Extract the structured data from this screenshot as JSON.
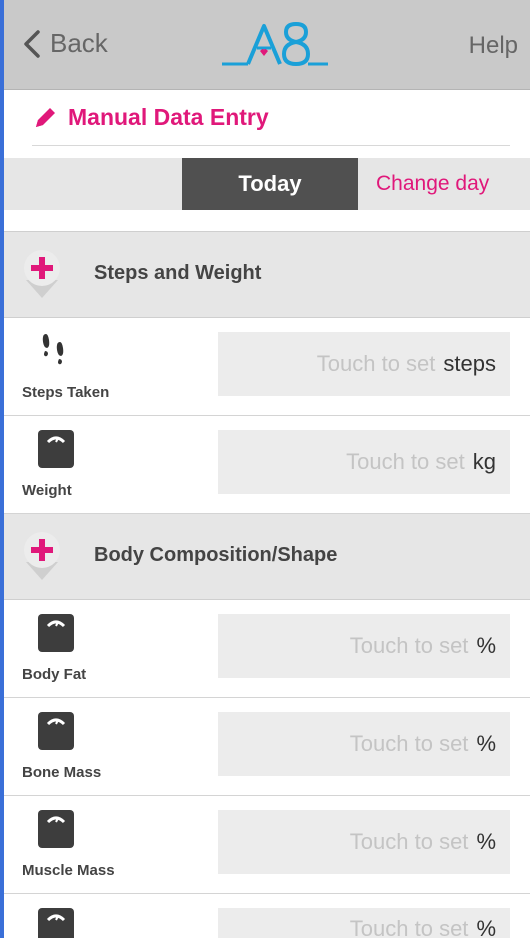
{
  "nav": {
    "back_label": "Back",
    "help_label": "Help",
    "logo_text": "A8"
  },
  "header": {
    "title": "Manual Data Entry"
  },
  "day_selector": {
    "today_label": "Today",
    "change_day_label": "Change day"
  },
  "sections": [
    {
      "label": "Steps and Weight",
      "rows": [
        {
          "label": "Steps Taken",
          "icon": "footprints-icon",
          "placeholder": "Touch to set",
          "unit": "steps"
        },
        {
          "label": "Weight",
          "icon": "scale-icon",
          "placeholder": "Touch to set",
          "unit": "kg"
        }
      ]
    },
    {
      "label": "Body Composition/Shape",
      "rows": [
        {
          "label": "Body Fat",
          "icon": "scale-icon",
          "placeholder": "Touch to set",
          "unit": "%"
        },
        {
          "label": "Bone Mass",
          "icon": "scale-icon",
          "placeholder": "Touch to set",
          "unit": "%"
        },
        {
          "label": "Muscle Mass",
          "icon": "scale-icon",
          "placeholder": "Touch to set",
          "unit": "%"
        },
        {
          "label": "",
          "icon": "scale-icon",
          "placeholder": "Touch to set",
          "unit": "%"
        }
      ]
    }
  ],
  "colors": {
    "accent": "#e0187a",
    "nav_bg": "#c9c9c9",
    "section_bg": "#e6e6e6",
    "today_bg": "#505050",
    "field_bg": "#ececec"
  }
}
